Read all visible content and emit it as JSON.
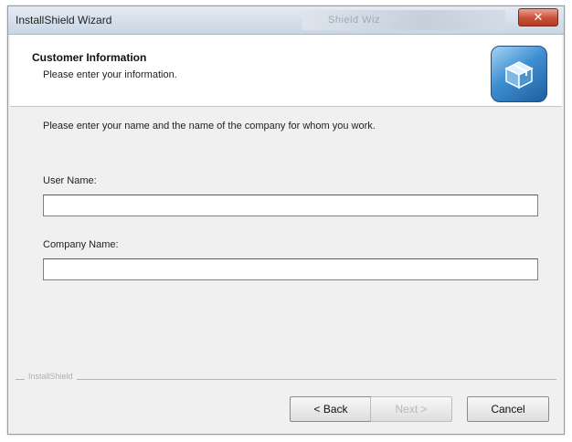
{
  "window": {
    "title": "InstallShield Wizard",
    "background_title": "Shield Wiz",
    "close_glyph": "✕"
  },
  "header": {
    "title": "Customer Information",
    "subtitle": "Please enter your information.",
    "logo_icon": "installshield-box-icon"
  },
  "form": {
    "prompt": "Please enter your name and the name of the company for whom you work.",
    "user_name": {
      "label": "User Name:",
      "value": ""
    },
    "company_name": {
      "label": "Company Name:",
      "value": ""
    }
  },
  "footer": {
    "brand": "InstallShield"
  },
  "buttons": {
    "back": "< Back",
    "next": "Next >",
    "cancel": "Cancel"
  },
  "colors": {
    "close_button": "#c8513b",
    "dialog_bg": "#f0f0f0",
    "logo_blue": "#3f8fd3"
  }
}
